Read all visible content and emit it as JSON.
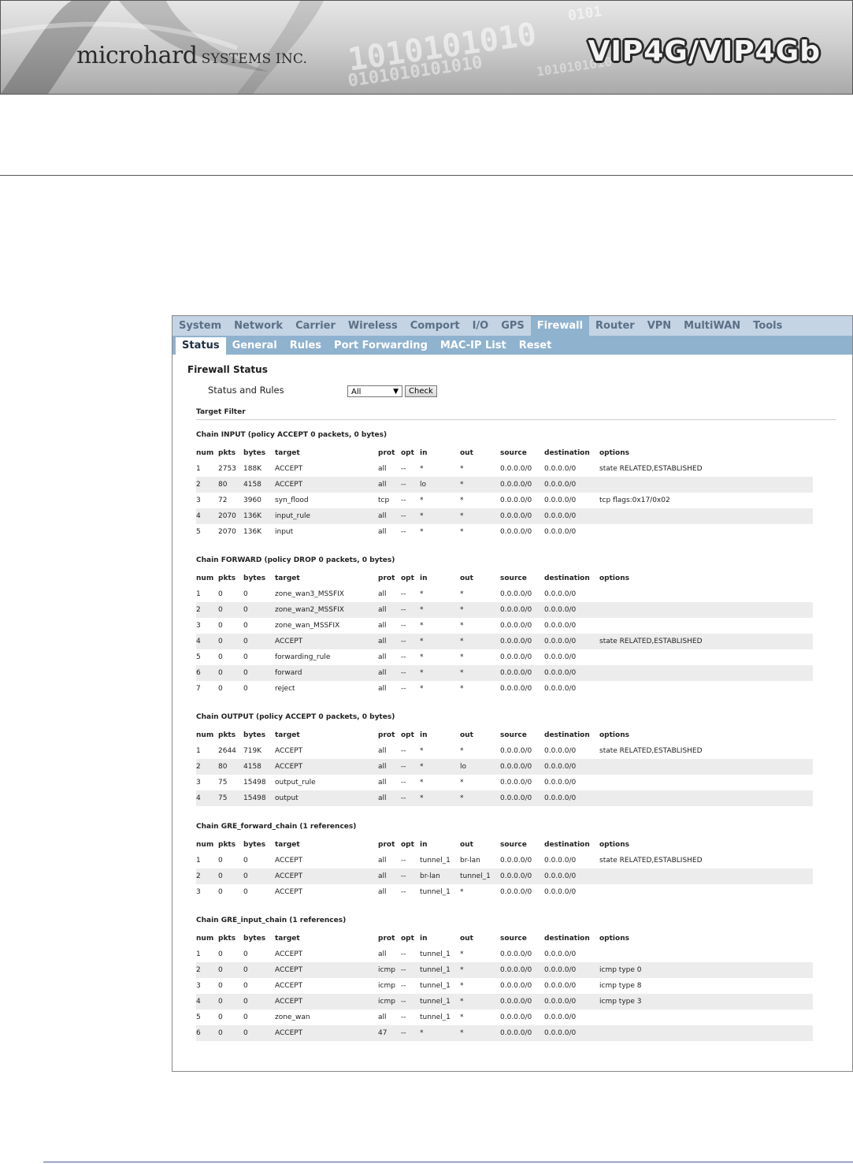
{
  "banner": {
    "company_main": "microhard",
    "company_suffix": "SYSTEMS INC.",
    "product": "VIP4G/VIP4Gb",
    "binary_lines": [
      "0101",
      "1010101010",
      "0101010101010",
      "1010101010"
    ]
  },
  "nav": {
    "main": [
      {
        "label": "System",
        "active": false
      },
      {
        "label": "Network",
        "active": false
      },
      {
        "label": "Carrier",
        "active": false
      },
      {
        "label": "Wireless",
        "active": false
      },
      {
        "label": "Comport",
        "active": false
      },
      {
        "label": "I/O",
        "active": false
      },
      {
        "label": "GPS",
        "active": false
      },
      {
        "label": "Firewall",
        "active": true
      },
      {
        "label": "Router",
        "active": false
      },
      {
        "label": "VPN",
        "active": false
      },
      {
        "label": "MultiWAN",
        "active": false
      },
      {
        "label": "Tools",
        "active": false
      }
    ],
    "sub": [
      {
        "label": "Status",
        "active": true
      },
      {
        "label": "General",
        "active": false
      },
      {
        "label": "Rules",
        "active": false
      },
      {
        "label": "Port Forwarding",
        "active": false
      },
      {
        "label": "MAC-IP List",
        "active": false
      },
      {
        "label": "Reset",
        "active": false
      }
    ]
  },
  "page": {
    "title": "Firewall Status",
    "status_label": "Status and Rules",
    "select_value": "All",
    "check_button": "Check",
    "target_filter": "Target Filter"
  },
  "columns": [
    "num",
    "pkts",
    "bytes",
    "target",
    "prot",
    "opt",
    "in",
    "out",
    "source",
    "destination",
    "options"
  ],
  "chains": [
    {
      "title": "Chain INPUT (policy ACCEPT 0 packets, 0 bytes)",
      "rows": [
        [
          "1",
          "2753",
          "188K",
          "ACCEPT",
          "all",
          "--",
          "*",
          "*",
          "0.0.0.0/0",
          "0.0.0.0/0",
          "state RELATED,ESTABLISHED"
        ],
        [
          "2",
          "80",
          "4158",
          "ACCEPT",
          "all",
          "--",
          "lo",
          "*",
          "0.0.0.0/0",
          "0.0.0.0/0",
          ""
        ],
        [
          "3",
          "72",
          "3960",
          "syn_flood",
          "tcp",
          "--",
          "*",
          "*",
          "0.0.0.0/0",
          "0.0.0.0/0",
          "tcp flags:0x17/0x02"
        ],
        [
          "4",
          "2070",
          "136K",
          "input_rule",
          "all",
          "--",
          "*",
          "*",
          "0.0.0.0/0",
          "0.0.0.0/0",
          ""
        ],
        [
          "5",
          "2070",
          "136K",
          "input",
          "all",
          "--",
          "*",
          "*",
          "0.0.0.0/0",
          "0.0.0.0/0",
          ""
        ]
      ]
    },
    {
      "title": "Chain FORWARD (policy DROP 0 packets, 0 bytes)",
      "rows": [
        [
          "1",
          "0",
          "0",
          "zone_wan3_MSSFIX",
          "all",
          "--",
          "*",
          "*",
          "0.0.0.0/0",
          "0.0.0.0/0",
          ""
        ],
        [
          "2",
          "0",
          "0",
          "zone_wan2_MSSFIX",
          "all",
          "--",
          "*",
          "*",
          "0.0.0.0/0",
          "0.0.0.0/0",
          ""
        ],
        [
          "3",
          "0",
          "0",
          "zone_wan_MSSFIX",
          "all",
          "--",
          "*",
          "*",
          "0.0.0.0/0",
          "0.0.0.0/0",
          ""
        ],
        [
          "4",
          "0",
          "0",
          "ACCEPT",
          "all",
          "--",
          "*",
          "*",
          "0.0.0.0/0",
          "0.0.0.0/0",
          "state RELATED,ESTABLISHED"
        ],
        [
          "5",
          "0",
          "0",
          "forwarding_rule",
          "all",
          "--",
          "*",
          "*",
          "0.0.0.0/0",
          "0.0.0.0/0",
          ""
        ],
        [
          "6",
          "0",
          "0",
          "forward",
          "all",
          "--",
          "*",
          "*",
          "0.0.0.0/0",
          "0.0.0.0/0",
          ""
        ],
        [
          "7",
          "0",
          "0",
          "reject",
          "all",
          "--",
          "*",
          "*",
          "0.0.0.0/0",
          "0.0.0.0/0",
          ""
        ]
      ]
    },
    {
      "title": "Chain OUTPUT (policy ACCEPT 0 packets, 0 bytes)",
      "rows": [
        [
          "1",
          "2644",
          "719K",
          "ACCEPT",
          "all",
          "--",
          "*",
          "*",
          "0.0.0.0/0",
          "0.0.0.0/0",
          "state RELATED,ESTABLISHED"
        ],
        [
          "2",
          "80",
          "4158",
          "ACCEPT",
          "all",
          "--",
          "*",
          "lo",
          "0.0.0.0/0",
          "0.0.0.0/0",
          ""
        ],
        [
          "3",
          "75",
          "15498",
          "output_rule",
          "all",
          "--",
          "*",
          "*",
          "0.0.0.0/0",
          "0.0.0.0/0",
          ""
        ],
        [
          "4",
          "75",
          "15498",
          "output",
          "all",
          "--",
          "*",
          "*",
          "0.0.0.0/0",
          "0.0.0.0/0",
          ""
        ]
      ]
    },
    {
      "title": "Chain GRE_forward_chain (1 references)",
      "rows": [
        [
          "1",
          "0",
          "0",
          "ACCEPT",
          "all",
          "--",
          "tunnel_1",
          "br-lan",
          "0.0.0.0/0",
          "0.0.0.0/0",
          "state RELATED,ESTABLISHED"
        ],
        [
          "2",
          "0",
          "0",
          "ACCEPT",
          "all",
          "--",
          "br-lan",
          "tunnel_1",
          "0.0.0.0/0",
          "0.0.0.0/0",
          ""
        ],
        [
          "3",
          "0",
          "0",
          "ACCEPT",
          "all",
          "--",
          "tunnel_1",
          "*",
          "0.0.0.0/0",
          "0.0.0.0/0",
          ""
        ]
      ]
    },
    {
      "title": "Chain GRE_input_chain (1 references)",
      "rows": [
        [
          "1",
          "0",
          "0",
          "ACCEPT",
          "all",
          "--",
          "tunnel_1",
          "*",
          "0.0.0.0/0",
          "0.0.0.0/0",
          ""
        ],
        [
          "2",
          "0",
          "0",
          "ACCEPT",
          "icmp",
          "--",
          "tunnel_1",
          "*",
          "0.0.0.0/0",
          "0.0.0.0/0",
          "icmp type 0"
        ],
        [
          "3",
          "0",
          "0",
          "ACCEPT",
          "icmp",
          "--",
          "tunnel_1",
          "*",
          "0.0.0.0/0",
          "0.0.0.0/0",
          "icmp type 8"
        ],
        [
          "4",
          "0",
          "0",
          "ACCEPT",
          "icmp",
          "--",
          "tunnel_1",
          "*",
          "0.0.0.0/0",
          "0.0.0.0/0",
          "icmp type 3"
        ],
        [
          "5",
          "0",
          "0",
          "zone_wan",
          "all",
          "--",
          "tunnel_1",
          "*",
          "0.0.0.0/0",
          "0.0.0.0/0",
          ""
        ],
        [
          "6",
          "0",
          "0",
          "ACCEPT",
          "47",
          "--",
          "*",
          "*",
          "0.0.0.0/0",
          "0.0.0.0/0",
          ""
        ]
      ]
    }
  ]
}
